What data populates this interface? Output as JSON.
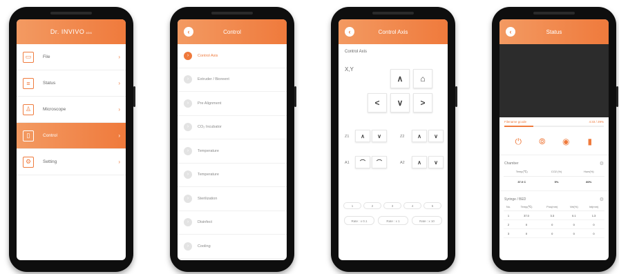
{
  "main_menu": {
    "brand": "Dr. INVIVO",
    "brand_suffix": "4D6",
    "items": [
      {
        "label": "File",
        "icon": "folder-icon",
        "glyph": "▭"
      },
      {
        "label": "Status",
        "icon": "list-icon",
        "glyph": "≡"
      },
      {
        "label": "Microscope",
        "icon": "microscope-icon",
        "glyph": "♙"
      },
      {
        "label": "Control",
        "icon": "syringe-icon",
        "glyph": "▯"
      },
      {
        "label": "Setting",
        "icon": "gear-icon",
        "glyph": "⚙"
      }
    ],
    "active_index": 3,
    "chevron": "›"
  },
  "control": {
    "title": "Control",
    "back_glyph": "‹",
    "items": [
      {
        "label": "Control Axis"
      },
      {
        "label": "Extruder / Bioreent"
      },
      {
        "label": "Pre Alignment"
      },
      {
        "label": "CO₂ Incubator"
      },
      {
        "label": "Temperature"
      },
      {
        "label": "Temperature"
      },
      {
        "label": "Sterilization"
      },
      {
        "label": "Disinfect"
      },
      {
        "label": "Cooling"
      }
    ],
    "item_glyph": "›"
  },
  "control_axis": {
    "title": "Control Axis",
    "section_label": "Control Axis",
    "xy_label": "X,Y",
    "glyphs": {
      "up": "∧",
      "down": "∨",
      "left": "<",
      "right": ">",
      "home": "⌂",
      "arc": "⌒"
    },
    "axis_labels": {
      "z1": "Z1",
      "z2": "Z2",
      "a1": "A1",
      "a2": "A2"
    },
    "number_buttons": [
      "1",
      "2",
      "3",
      "4",
      "5"
    ],
    "rate_buttons": [
      "Rate : x 0.1",
      "Rate : x 1",
      "Rate : x 10"
    ]
  },
  "status": {
    "title": "Status",
    "file_label": "Filename gcode",
    "file_progress_text": "4:33 / 29%",
    "progress": 0.29,
    "action_glyphs": [
      "⏻",
      "⦾",
      "◉",
      "▮"
    ],
    "chamber_title": "Chamber",
    "gear_glyph": "⚙",
    "chamber_headers": [
      "Temp(℃)",
      "CO2 (%)",
      "Hum(%)"
    ],
    "chamber_values": [
      "37.0 C",
      "5%",
      "80%"
    ],
    "syringe_title": "Syringe / BED",
    "syringe_headers": [
      "No.",
      "Temp(℃)",
      "Pos(mm)",
      "Vel(%)",
      "Int(mm)"
    ],
    "syringe_rows": [
      [
        "1",
        "37.0",
        "3.3",
        "0.1",
        "1.3"
      ],
      [
        "2",
        "0",
        "0",
        "0",
        "0"
      ],
      [
        "3",
        "0",
        "0",
        "0",
        "0"
      ]
    ]
  },
  "colors": {
    "accent": "#ef7a3c",
    "accent_light": "#f39a62",
    "camera": "#2c2c2c"
  }
}
